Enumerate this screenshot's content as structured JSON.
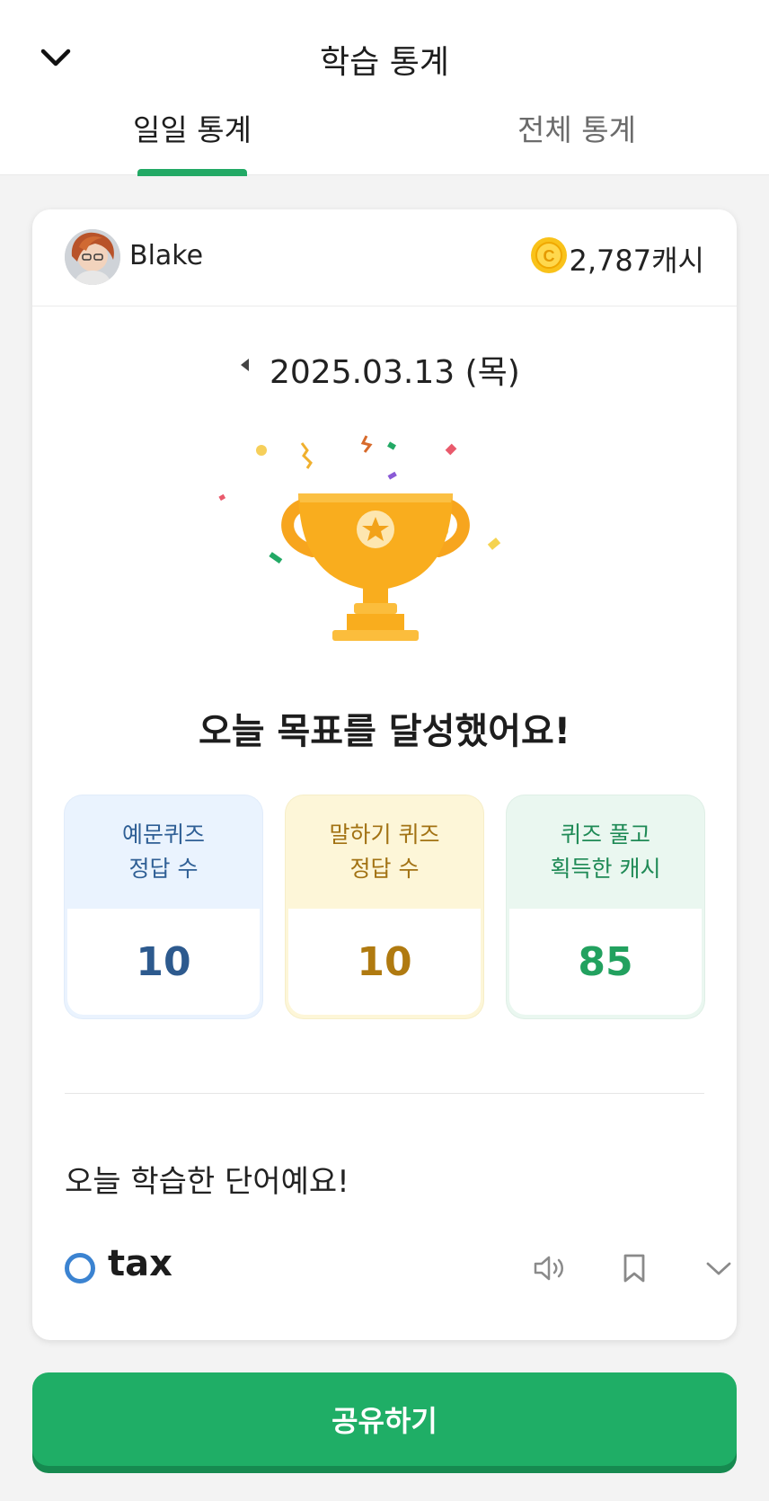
{
  "header": {
    "title": "학습 통계",
    "tabs": [
      {
        "label": "일일 통계",
        "active": true
      },
      {
        "label": "전체 통계",
        "active": false
      }
    ],
    "accent_color": "#22a965"
  },
  "profile": {
    "username": "Blake",
    "coins": "2,787캐시"
  },
  "date": {
    "current": "2025.03.13 (목)"
  },
  "goal": {
    "message": "오늘 목표를 달성했어요!"
  },
  "stats": [
    {
      "label": "예문퀴즈\n정답 수",
      "value": "10",
      "color": "#2d5a8e"
    },
    {
      "label": "말하기 퀴즈\n정답 수",
      "value": "10",
      "color": "#b07a10"
    },
    {
      "label": "퀴즈 풀고\n획득한 캐시",
      "value": "85",
      "color": "#22a15f"
    }
  ],
  "words": {
    "title": "오늘 학습한 단어예요!",
    "items": [
      {
        "word": "tax"
      }
    ]
  },
  "actions": {
    "share_label": "공유하기",
    "share_color": "#1fae66"
  },
  "icons": {
    "back": "chevron-down-icon",
    "coin": "coin-icon",
    "prev": "triangle-left-icon",
    "trophy": "trophy-icon",
    "speaker": "speaker-icon",
    "bookmark": "bookmark-icon",
    "expand": "chevron-down-icon"
  }
}
